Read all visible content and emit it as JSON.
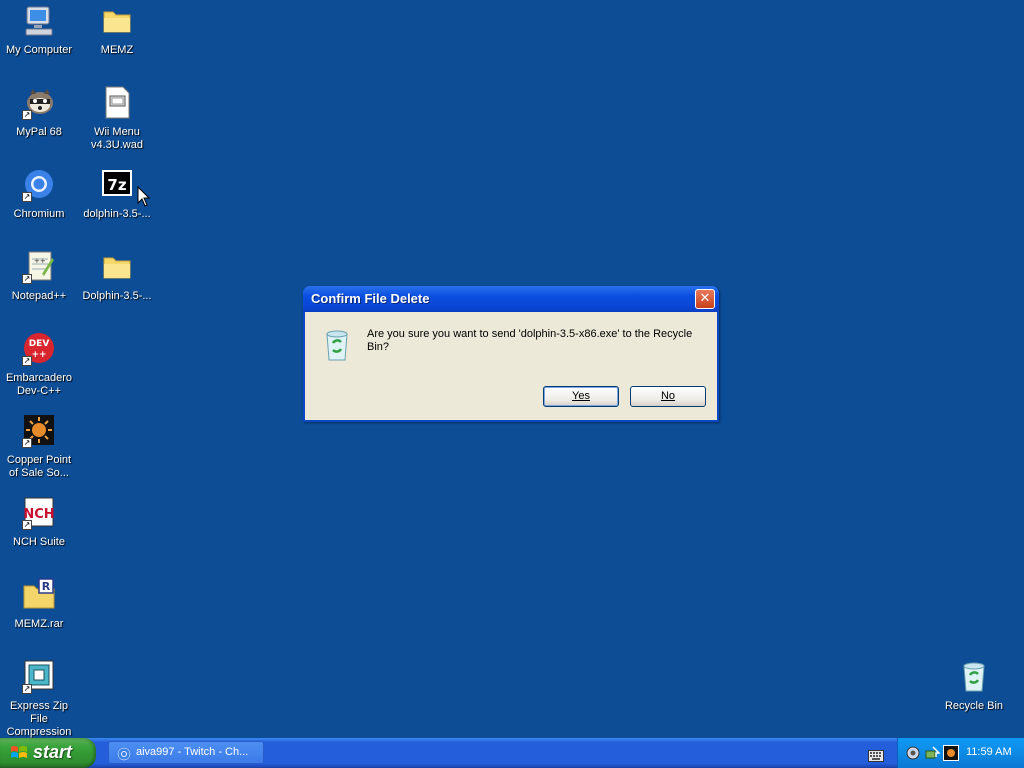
{
  "desktop": {
    "icons": [
      {
        "label": "My Computer",
        "icon": "my-computer-icon"
      },
      {
        "label": "MEMZ",
        "icon": "folder-icon"
      },
      {
        "label": "MyPal 68",
        "icon": "mypal-raccoon-icon"
      },
      {
        "label": "Wii Menu\nv4.3U.wad",
        "icon": "wad-file-icon"
      },
      {
        "label": "Chromium",
        "icon": "chromium-icon"
      },
      {
        "label": "dolphin-3.5-...",
        "icon": "7z-archive-icon"
      },
      {
        "label": "Notepad++",
        "icon": "notepad-plus-plus-icon"
      },
      {
        "label": "Dolphin-3.5-...",
        "icon": "folder-icon"
      },
      {
        "label": "Embarcadero\nDev-C++",
        "icon": "dev-cpp-icon"
      },
      {
        "label": "Copper Point\nof Sale So...",
        "icon": "copper-point-icon"
      },
      {
        "label": "NCH Suite",
        "icon": "nch-suite-icon"
      },
      {
        "label": "MEMZ.rar",
        "icon": "rar-archive-icon"
      },
      {
        "label": "Express Zip File\nCompression",
        "icon": "express-zip-icon"
      },
      {
        "label": "Recycle Bin",
        "icon": "recycle-bin-icon"
      }
    ]
  },
  "dialog": {
    "title": "Confirm File Delete",
    "close_glyph": "✕",
    "message": "Are you sure you want to send 'dolphin-3.5-x86.exe' to the Recycle Bin?",
    "yes_label": "Yes",
    "no_label": "No"
  },
  "taskbar": {
    "start_label": "start",
    "task_label": "aiva997 - Twitch - Ch...",
    "clock": "11:59 AM"
  },
  "colors": {
    "desktop_bg": "#0c4d96",
    "titlebar": "#0a4ee0",
    "taskbar": "#245edb",
    "start_green": "#39a33a",
    "tray": "#0d8be5"
  }
}
